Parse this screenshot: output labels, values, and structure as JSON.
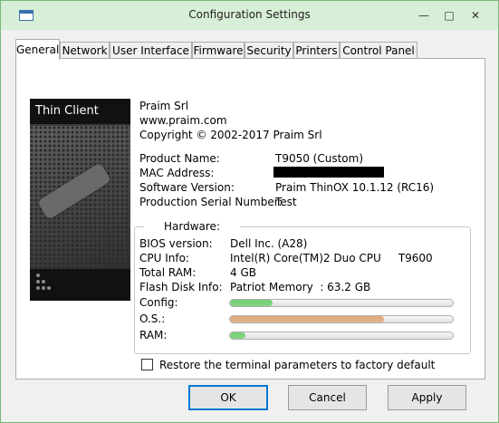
{
  "window": {
    "title": "Configuration Settings",
    "controls": {
      "minimize": "—",
      "maximize": "□",
      "close": "✕"
    }
  },
  "tabs": [
    "General",
    "Network",
    "User Interface",
    "Firmware",
    "Security",
    "Printers",
    "Control Panel"
  ],
  "active_tab": "General",
  "banner": {
    "title": "Thin Client"
  },
  "vendor": {
    "name": "Praim Srl",
    "website": "www.praim.com",
    "copyright": "Copyright © 2002-2017 Praim Srl"
  },
  "product": {
    "name_label": "Product Name:",
    "name_value": "T9050 (Custom)",
    "mac_label": "MAC Address:",
    "software_label": "Software Version:",
    "software_value": "Praim ThinOX 10.1.12 (RC16)",
    "serial_label": "Production Serial Number:",
    "serial_value": "Test"
  },
  "hardware": {
    "title": "Hardware:",
    "bios_label": "BIOS version:",
    "bios_value": "Dell Inc. (A28)",
    "cpu_label": "CPU Info:",
    "cpu_value": "Intel(R) Core(TM)2 Duo CPU     T9600",
    "ram_label": "Total RAM:",
    "ram_value": "4 GB",
    "flash_label": "Flash Disk Info:",
    "flash_value": "Patriot Memory  : 63.2 GB",
    "usage": [
      {
        "label": "Config:",
        "fraction": 0.19,
        "color": "#6fcf6f"
      },
      {
        "label": "O.S.:",
        "fraction": 0.69,
        "color": "#e0a878"
      },
      {
        "label": "RAM:",
        "fraction": 0.07,
        "color": "#6fcf6f"
      }
    ]
  },
  "restore": {
    "label": "Restore the terminal parameters to factory default",
    "checked": false
  },
  "buttons": {
    "ok": "OK",
    "cancel": "Cancel",
    "apply": "Apply"
  },
  "colors": {
    "accent": "#0078d7",
    "titlebar": "#d7eed7"
  }
}
